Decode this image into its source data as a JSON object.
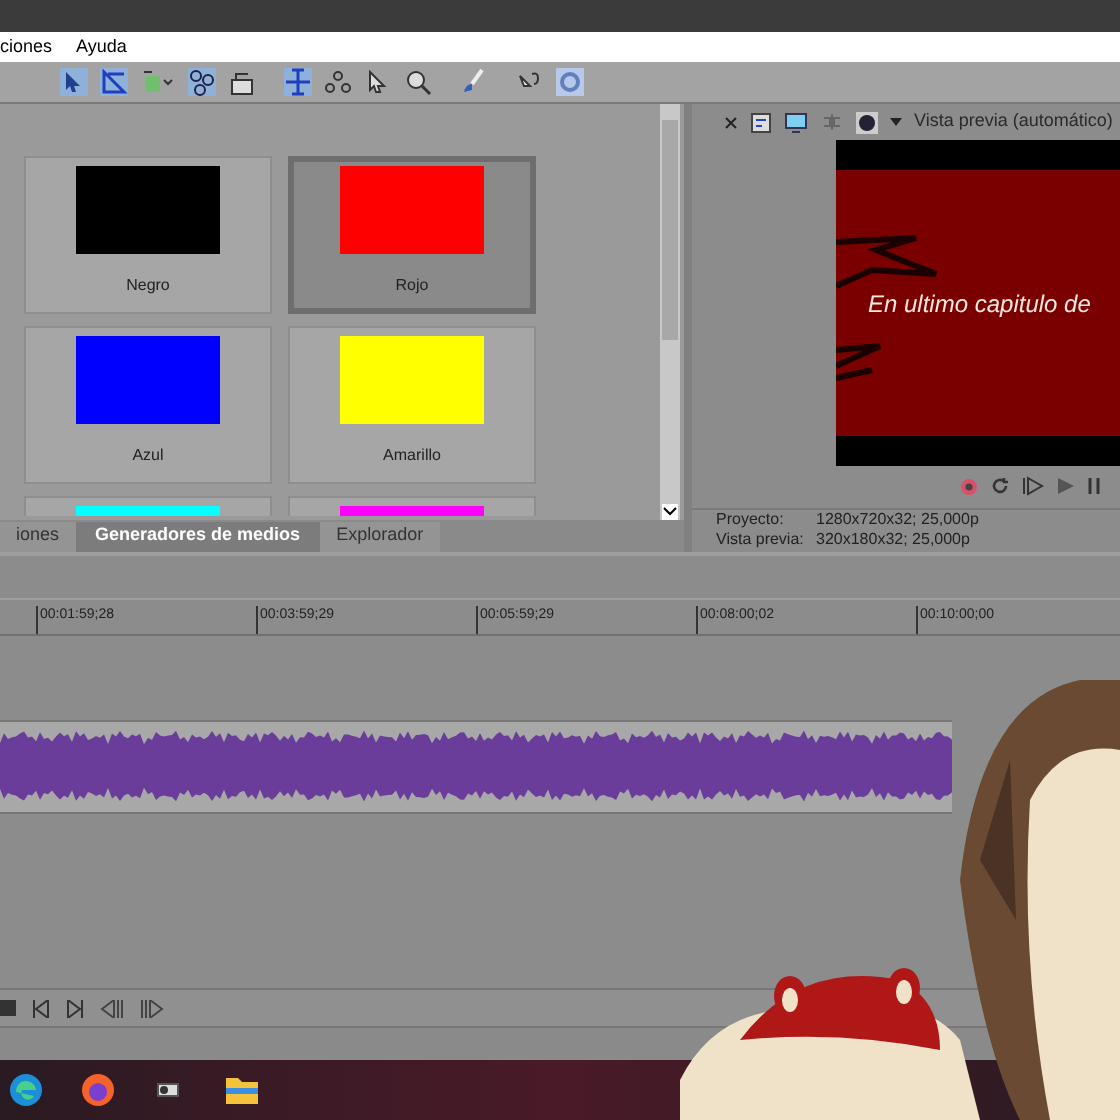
{
  "menu": [
    "ciones",
    "Ayuda"
  ],
  "generators": [
    {
      "label": "Negro",
      "color": "#000000",
      "selected": false
    },
    {
      "label": "Rojo",
      "color": "#ff0000",
      "selected": true
    },
    {
      "label": "Azul",
      "color": "#0000ff",
      "selected": false
    },
    {
      "label": "Amarillo",
      "color": "#ffff00",
      "selected": false
    },
    {
      "color": "#00ffff",
      "selected": false
    },
    {
      "color": "#ff00ff",
      "selected": false
    }
  ],
  "tabs": [
    {
      "label": "iones",
      "selected": false
    },
    {
      "label": "Generadores de medios",
      "selected": true
    },
    {
      "label": "Explorador",
      "selected": false
    }
  ],
  "preview": {
    "mode": "Vista previa (automático)",
    "caption": "En ultimo capitulo de",
    "info": [
      {
        "label": "Proyecto:",
        "value": "1280x720x32; 25,000p"
      },
      {
        "label": "Vista previa:",
        "value": "320x180x32; 25,000p"
      }
    ]
  },
  "ruler": [
    "00:01:59;28",
    "00:03:59;29",
    "00:05:59;29",
    "00:08:00;02",
    "00:10:00;00"
  ],
  "overlay": {
    "kind": "picture"
  }
}
